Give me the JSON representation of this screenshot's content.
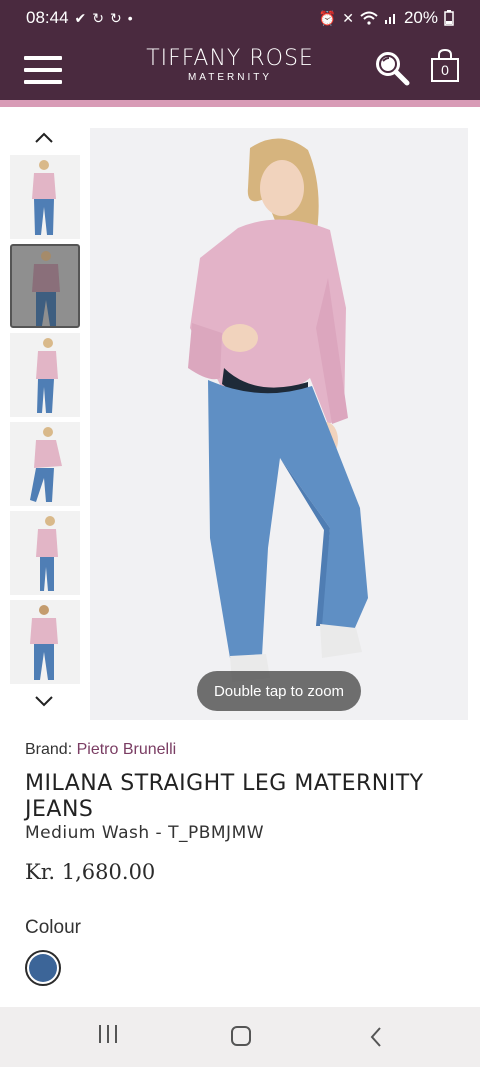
{
  "status_bar": {
    "time": "08:44",
    "battery": "20%",
    "left_icons": [
      "check-icon",
      "sync-icon",
      "sync-icon",
      "dot-icon"
    ],
    "right_icons": [
      "alarm-icon",
      "mute-icon",
      "wifi-icon",
      "signal-icon",
      "battery-icon"
    ]
  },
  "header": {
    "brand_name": "TIFFANY ROSE",
    "brand_sub": "MATERNITY",
    "cart_count": "0",
    "background_color": "#4a2a3f",
    "accent_color": "#d89bb6"
  },
  "gallery": {
    "thumbnails": [
      {
        "label": "front view",
        "active": false
      },
      {
        "label": "front view dark",
        "active": true
      },
      {
        "label": "side view",
        "active": false
      },
      {
        "label": "three-quarter view",
        "active": false
      },
      {
        "label": "side profile",
        "active": false
      },
      {
        "label": "back view",
        "active": false
      }
    ],
    "zoom_hint": "Double tap to zoom"
  },
  "product": {
    "brand_label": "Brand:",
    "brand_name": "Pietro Brunelli",
    "title": "MILANA STRAIGHT LEG MATERNITY JEANS",
    "subtitle": "Medium Wash - T_PBMJMW",
    "price": "Kr. 1,680.00",
    "colour_label": "Colour",
    "swatch_color": "#3c6598"
  }
}
